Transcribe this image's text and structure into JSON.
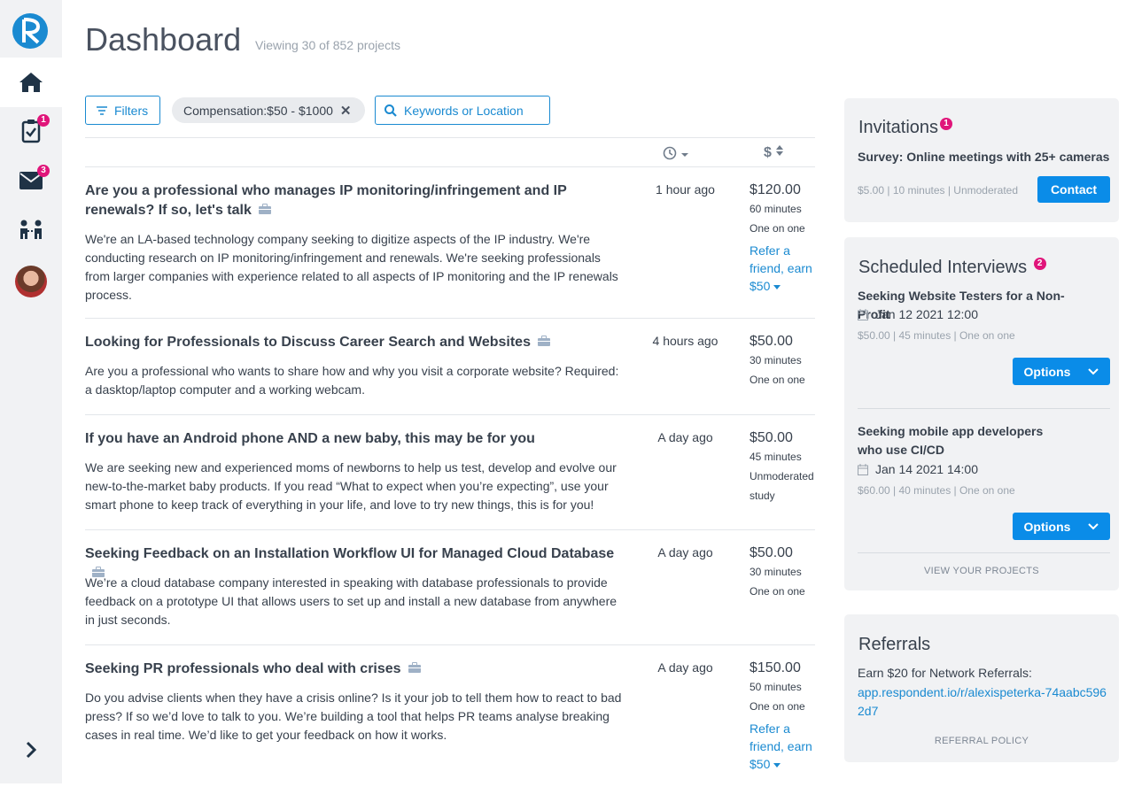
{
  "header": {
    "title": "Dashboard",
    "subtitle": "Viewing 30 of 852 projects"
  },
  "sidebar": {
    "items": [
      {
        "icon": "home-icon",
        "badge": ""
      },
      {
        "icon": "clipboard-check-icon",
        "badge": "1"
      },
      {
        "icon": "mail-icon",
        "badge": "3"
      },
      {
        "icon": "people-icon",
        "badge": ""
      },
      {
        "icon": "avatar",
        "badge": ""
      }
    ],
    "expand_icon": "chevron-right-icon"
  },
  "toolbar": {
    "filters_label": "Filters",
    "chip_key": "Compensation:",
    "chip_value": " $50 - $1000",
    "search_placeholder": "Keywords or Location"
  },
  "list": {
    "sort_pay_symbol": "$",
    "projects": [
      {
        "title": "Are you a professional who manages IP monitoring/infringement and IP renewals? If so, let's talk",
        "description": "We're an LA-based technology company seeking to digitize aspects of the IP industry. We're conducting research on IP monitoring/infringement and renewals. We're seeking professionals from larger companies with experience related to all aspects of IP monitoring and the IP renewals process.",
        "time": "1 hour ago",
        "pay": "$120.00",
        "duration": "60 minutes",
        "type": "One on one",
        "refer": "Refer a friend, earn $50"
      },
      {
        "title": "Looking for Professionals to Discuss Career Search and Websites",
        "description": "Are you a professional who wants to share how and why you visit a corporate website? Required: a dasktop/laptop computer and a working webcam.",
        "time": "4 hours ago",
        "pay": "$50.00",
        "duration": "30 minutes",
        "type": "One on one"
      },
      {
        "title": "If you have an Android phone AND a new baby, this may be for you",
        "description": "We are seeking new and experienced moms of newborns to help us test, develop and evolve our new-to-the-market baby products. If you read “What to expect when you’re expecting”, use your smart phone to keep track of everything in your life, and love to try new things, this is for you!",
        "time": "A day ago",
        "pay": "$50.00",
        "duration": "45 minutes",
        "type": "Unmoderated study"
      },
      {
        "title": "Seeking Feedback on an Installation Workflow UI for Managed Cloud Database",
        "description": "We’re a cloud database company interested in speaking with database professionals to provide feedback on a prototype UI that allows users to set up and install a new database from anywhere in just seconds.",
        "time": "A day ago",
        "pay": "$50.00",
        "duration": "30 minutes",
        "type": "One on one"
      },
      {
        "title": "Seeking PR professionals who deal with crises",
        "description": "Do you advise clients when they have a crisis online? Is it your job to tell them how to react to bad press? If so we’d love to talk to you. We’re building a tool that helps PR teams analyse breaking cases in real time. We’d like to get your feedback on how it works.",
        "time": "A day ago",
        "pay": "$150.00",
        "duration": "50 minutes",
        "type": "One on one",
        "refer": "Refer a friend, earn $50"
      }
    ]
  },
  "invitations": {
    "title": "Invitations",
    "badge": "1",
    "item_title": "Survey: Online meetings with 25+ cameras",
    "item_meta": "$5.00 | 10 minutes | Unmoderated",
    "contact_label": "Contact"
  },
  "scheduled": {
    "title": "Scheduled Interviews",
    "badge": "2",
    "items": [
      {
        "title": "Seeking Website Testers for a Non-Profit",
        "date": "Jan 12 2021 12:00",
        "meta": "$50.00 | 45 minutes | One on one",
        "options_label": "Options"
      },
      {
        "title": "Seeking mobile app developers who use CI/CD",
        "date": "Jan 14 2021 14:00",
        "meta": "$60.00 | 40 minutes | One on one",
        "options_label": "Options"
      }
    ],
    "view_link": "VIEW YOUR PROJECTS"
  },
  "referrals": {
    "title": "Referrals",
    "text": "Earn $20 for Network Referrals:",
    "url": "app.respondent.io/r/alexispeterka-74aabc5962d7",
    "policy_link": "REFERRAL POLICY"
  },
  "colors": {
    "accent": "#1a8ad1",
    "button": "#0a8ce8",
    "badge": "#e0157a",
    "sidebar_bg": "#f1f2f4"
  }
}
